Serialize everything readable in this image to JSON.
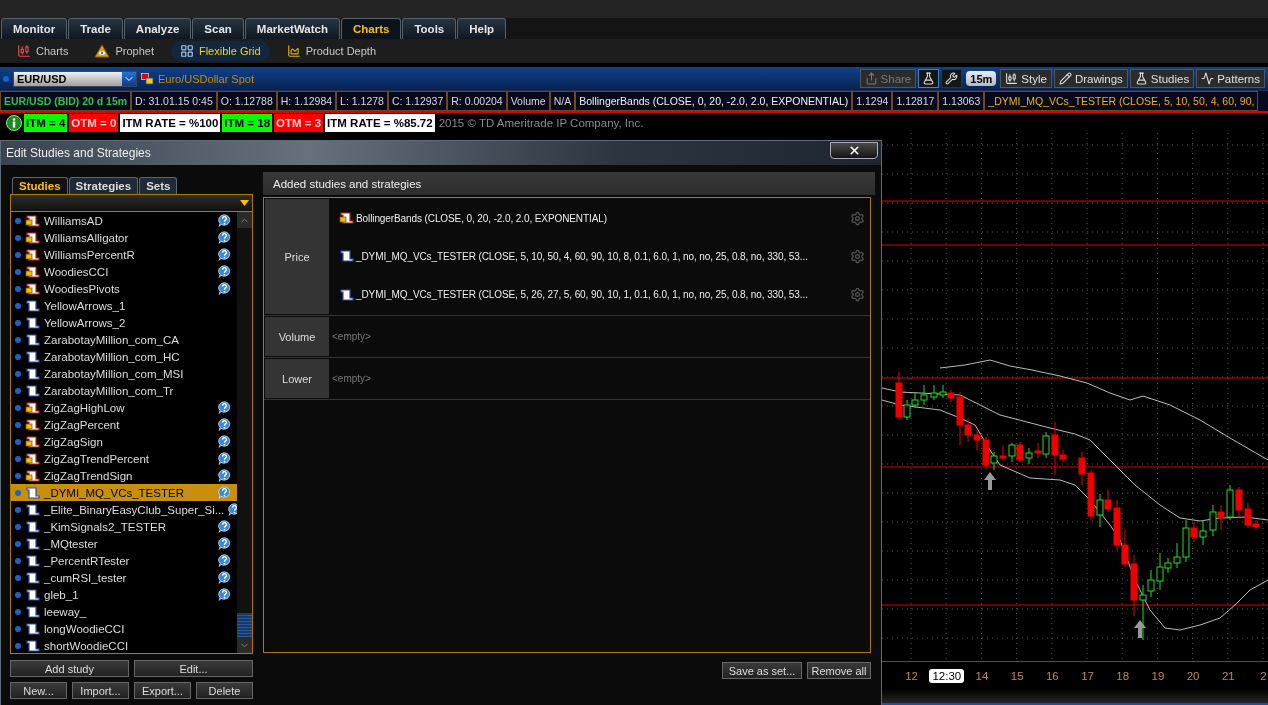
{
  "top_tabs": [
    {
      "label": "Monitor",
      "selected": false
    },
    {
      "label": "Trade",
      "selected": false
    },
    {
      "label": "Analyze",
      "selected": false
    },
    {
      "label": "Scan",
      "selected": false
    },
    {
      "label": "MarketWatch",
      "selected": false
    },
    {
      "label": "Charts",
      "selected": true
    },
    {
      "label": "Tools",
      "selected": false
    },
    {
      "label": "Help",
      "selected": false
    }
  ],
  "sub_tabs": [
    {
      "label": "Charts",
      "kind": "charts",
      "selected": false
    },
    {
      "label": "Prophet",
      "kind": "prophet",
      "selected": false
    },
    {
      "label": "Flexible Grid",
      "kind": "grid",
      "selected": true
    },
    {
      "label": "Product Depth",
      "kind": "depth",
      "selected": false
    }
  ],
  "symbol": {
    "value": "EUR/USD",
    "description": "Euro/USDollar Spot"
  },
  "toolbar": {
    "share": {
      "label": "Share",
      "disabled": true
    },
    "interval": "15m",
    "buttons": [
      {
        "label": "Style",
        "kind": "style"
      },
      {
        "label": "Drawings",
        "kind": "drawings"
      },
      {
        "label": "Studies",
        "kind": "studies"
      },
      {
        "label": "Patterns",
        "kind": "patterns"
      }
    ]
  },
  "info_cells": [
    {
      "text": "EUR/USD (BID) 20 d 15m",
      "kind": "symbol"
    },
    {
      "text": "D: 31.01.15 0:45",
      "kind": "value"
    },
    {
      "text": "O: 1.12788",
      "kind": "value"
    },
    {
      "text": "H: 1.12984",
      "kind": "value"
    },
    {
      "text": "L: 1.1278",
      "kind": "value"
    },
    {
      "text": "C: 1.12937",
      "kind": "value"
    },
    {
      "text": "R: 0.00204",
      "kind": "value"
    },
    {
      "text": "Volume",
      "kind": "value"
    },
    {
      "text": "N/A",
      "kind": "value"
    },
    {
      "text": "BollingerBands (CLOSE, 0, 20, -2.0, 2.0, EXPONENTIAL)",
      "kind": "study"
    },
    {
      "text": "1.1294",
      "kind": "value"
    },
    {
      "text": "1.12817",
      "kind": "value"
    },
    {
      "text": "1.13063",
      "kind": "value"
    },
    {
      "text": "_DYMI_MQ_VCs_TESTER (CLOSE, 5, 10, 50, 4, 60, 90,",
      "kind": "study_alt"
    }
  ],
  "badges": [
    {
      "text": "ITM = 4",
      "color": "#00ff00"
    },
    {
      "text": "OTM = 0",
      "color": "#ff0000"
    },
    {
      "text": "ITM RATE = %100",
      "color": "#ffffff"
    },
    {
      "text": "ITM = 18",
      "color": "#00ff00"
    },
    {
      "text": "OTM = 3",
      "color": "#ff0000"
    },
    {
      "text": "ITM RATE = %85.72",
      "color": "#ffffff"
    }
  ],
  "copyright": "2015 © TD Ameritrade IP Company, Inc.",
  "dialog": {
    "title": "Edit Studies and Strategies",
    "tabs": [
      {
        "label": "Studies",
        "selected": true
      },
      {
        "label": "Strategies",
        "selected": false
      },
      {
        "label": "Sets",
        "selected": false
      }
    ],
    "studies": [
      {
        "name": "WilliamsAD",
        "kind": "locked",
        "help": true,
        "selected": false
      },
      {
        "name": "WilliamsAlligator",
        "kind": "locked",
        "help": true,
        "selected": false
      },
      {
        "name": "WilliamsPercentR",
        "kind": "locked",
        "help": true,
        "selected": false
      },
      {
        "name": "WoodiesCCI",
        "kind": "locked",
        "help": true,
        "selected": false
      },
      {
        "name": "WoodiesPivots",
        "kind": "locked",
        "help": true,
        "selected": false
      },
      {
        "name": "YellowArrows_1",
        "kind": "custom",
        "help": false,
        "selected": false
      },
      {
        "name": "YellowArrows_2",
        "kind": "custom",
        "help": false,
        "selected": false
      },
      {
        "name": "ZarabotayMillion_com_CA",
        "kind": "custom",
        "help": false,
        "selected": false
      },
      {
        "name": "ZarabotayMillion_com_HC",
        "kind": "custom",
        "help": false,
        "selected": false
      },
      {
        "name": "ZarabotayMillion_com_MSI",
        "kind": "custom",
        "help": false,
        "selected": false
      },
      {
        "name": "ZarabotayMillion_com_Tr",
        "kind": "custom",
        "help": false,
        "selected": false
      },
      {
        "name": "ZigZagHighLow",
        "kind": "locked",
        "help": true,
        "selected": false
      },
      {
        "name": "ZigZagPercent",
        "kind": "locked",
        "help": true,
        "selected": false
      },
      {
        "name": "ZigZagSign",
        "kind": "locked",
        "help": true,
        "selected": false
      },
      {
        "name": "ZigZagTrendPercent",
        "kind": "locked",
        "help": true,
        "selected": false
      },
      {
        "name": "ZigZagTrendSign",
        "kind": "locked",
        "help": true,
        "selected": false
      },
      {
        "name": "_DYMI_MQ_VCs_TESTER",
        "kind": "custom",
        "help": true,
        "selected": true
      },
      {
        "name": "_Elite_BinaryEasyClub_Super_Si...",
        "kind": "custom",
        "help": true,
        "selected": false
      },
      {
        "name": "_KimSignals2_TESTER",
        "kind": "custom",
        "help": true,
        "selected": false
      },
      {
        "name": "_MQtester",
        "kind": "custom",
        "help": true,
        "selected": false
      },
      {
        "name": "_PercentRTester",
        "kind": "custom",
        "help": true,
        "selected": false
      },
      {
        "name": "_cumRSI_tester",
        "kind": "custom",
        "help": true,
        "selected": false
      },
      {
        "name": "gleb_1",
        "kind": "custom",
        "help": true,
        "selected": false
      },
      {
        "name": "leeway_",
        "kind": "custom",
        "help": false,
        "selected": false
      },
      {
        "name": "longWoodieCCI",
        "kind": "custom",
        "help": false,
        "selected": false
      },
      {
        "name": "shortWoodieCCI",
        "kind": "custom",
        "help": false,
        "selected": false
      }
    ],
    "buttons_top": [
      "Add study",
      "Edit..."
    ],
    "buttons_bottom": [
      "New...",
      "Import...",
      "Export...",
      "Delete"
    ],
    "added": {
      "title": "Added studies and strategies",
      "groups": [
        {
          "label": "Price",
          "entries": [
            {
              "text": "BollingerBands (CLOSE, 0, 20, -2.0, 2.0, EXPONENTIAL)",
              "kind": "locked"
            },
            {
              "text": "_DYMI_MQ_VCs_TESTER (CLOSE, 5, 10, 50, 4, 60, 90, 10, 8, 0.1, 6.0, 1, no, no, 25, 0.8, no, 330, 53...",
              "kind": "custom"
            },
            {
              "text": "_DYMI_MQ_VCs_TESTER (CLOSE, 5, 26, 27, 5, 60, 90, 10, 1, 0.1, 6.0, 1, no, no, 25, 0.8, no, 330, 53...",
              "kind": "custom"
            }
          ]
        },
        {
          "label": "Volume",
          "empty_text": "<empty>"
        },
        {
          "label": "Lower",
          "empty_text": "<empty>"
        }
      ]
    },
    "actions": [
      "Save as set...",
      "Remove all"
    ]
  },
  "chart": {
    "x_labels": [
      {
        "text": "12",
        "selected": false
      },
      {
        "text": "12:30",
        "selected": true
      },
      {
        "text": "14",
        "selected": false
      },
      {
        "text": "15",
        "selected": false
      },
      {
        "text": "16",
        "selected": false
      },
      {
        "text": "17",
        "selected": false
      },
      {
        "text": "18",
        "selected": false
      },
      {
        "text": "19",
        "selected": false
      },
      {
        "text": "20",
        "selected": false
      },
      {
        "text": "21",
        "selected": false
      },
      {
        "text": "2",
        "selected": false
      }
    ]
  }
}
